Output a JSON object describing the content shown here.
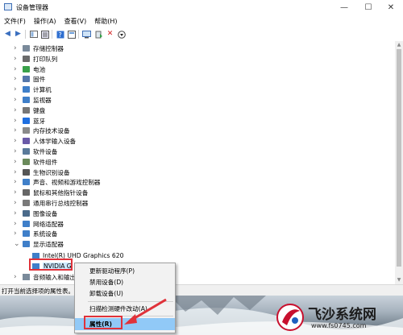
{
  "window": {
    "title": "设备管理器",
    "minimize": "—",
    "maximize": "☐",
    "close": "✕"
  },
  "menu": [
    "文件(F)",
    "操作(A)",
    "查看(V)",
    "帮助(H)"
  ],
  "tree": [
    {
      "label": "存储控制器",
      "icon": "storage-controller-icon",
      "expand": "›"
    },
    {
      "label": "打印队列",
      "icon": "printer-icon",
      "expand": "›"
    },
    {
      "label": "电池",
      "icon": "battery-icon",
      "expand": "›"
    },
    {
      "label": "固件",
      "icon": "firmware-icon",
      "expand": "›"
    },
    {
      "label": "计算机",
      "icon": "computer-icon",
      "expand": "›"
    },
    {
      "label": "监视器",
      "icon": "monitor-icon",
      "expand": "›"
    },
    {
      "label": "键盘",
      "icon": "keyboard-icon",
      "expand": "›"
    },
    {
      "label": "蓝牙",
      "icon": "bluetooth-icon",
      "expand": "›"
    },
    {
      "label": "内存技术设备",
      "icon": "memory-icon",
      "expand": "›"
    },
    {
      "label": "人体学输入设备",
      "icon": "hid-icon",
      "expand": "›"
    },
    {
      "label": "软件设备",
      "icon": "software-device-icon",
      "expand": "›"
    },
    {
      "label": "软件组件",
      "icon": "software-component-icon",
      "expand": "›"
    },
    {
      "label": "生物识别设备",
      "icon": "biometric-icon",
      "expand": "›"
    },
    {
      "label": "声音、视频和游戏控制器",
      "icon": "sound-icon",
      "expand": "›"
    },
    {
      "label": "鼠标和其他指针设备",
      "icon": "mouse-icon",
      "expand": "›"
    },
    {
      "label": "通用串行总线控制器",
      "icon": "usb-icon",
      "expand": "›"
    },
    {
      "label": "图像设备",
      "icon": "camera-icon",
      "expand": "›"
    },
    {
      "label": "网络适配器",
      "icon": "network-icon",
      "expand": "›"
    },
    {
      "label": "系统设备",
      "icon": "system-device-icon",
      "expand": "›"
    },
    {
      "label": "显示适配器",
      "icon": "display-adapter-icon",
      "expand": "⌄"
    }
  ],
  "display_children": [
    "Intel(R) UHD Graphics 620",
    "NVIDIA G"
  ],
  "below_row": "音频输入和输出",
  "status_text": "打开当前选择项的属性表。",
  "context_menu": {
    "items": [
      "更新驱动程序(P)",
      "禁用设备(D)",
      "卸载设备(U)",
      "扫描检测硬件改动(A)",
      "属性(R)"
    ]
  },
  "watermark": {
    "brand": "飞沙系统网",
    "url": "www.fs0745.com"
  },
  "colors": {
    "highlight": "#91c9f7",
    "annotation": "#e0323a",
    "folder": "#3f7fc9"
  }
}
